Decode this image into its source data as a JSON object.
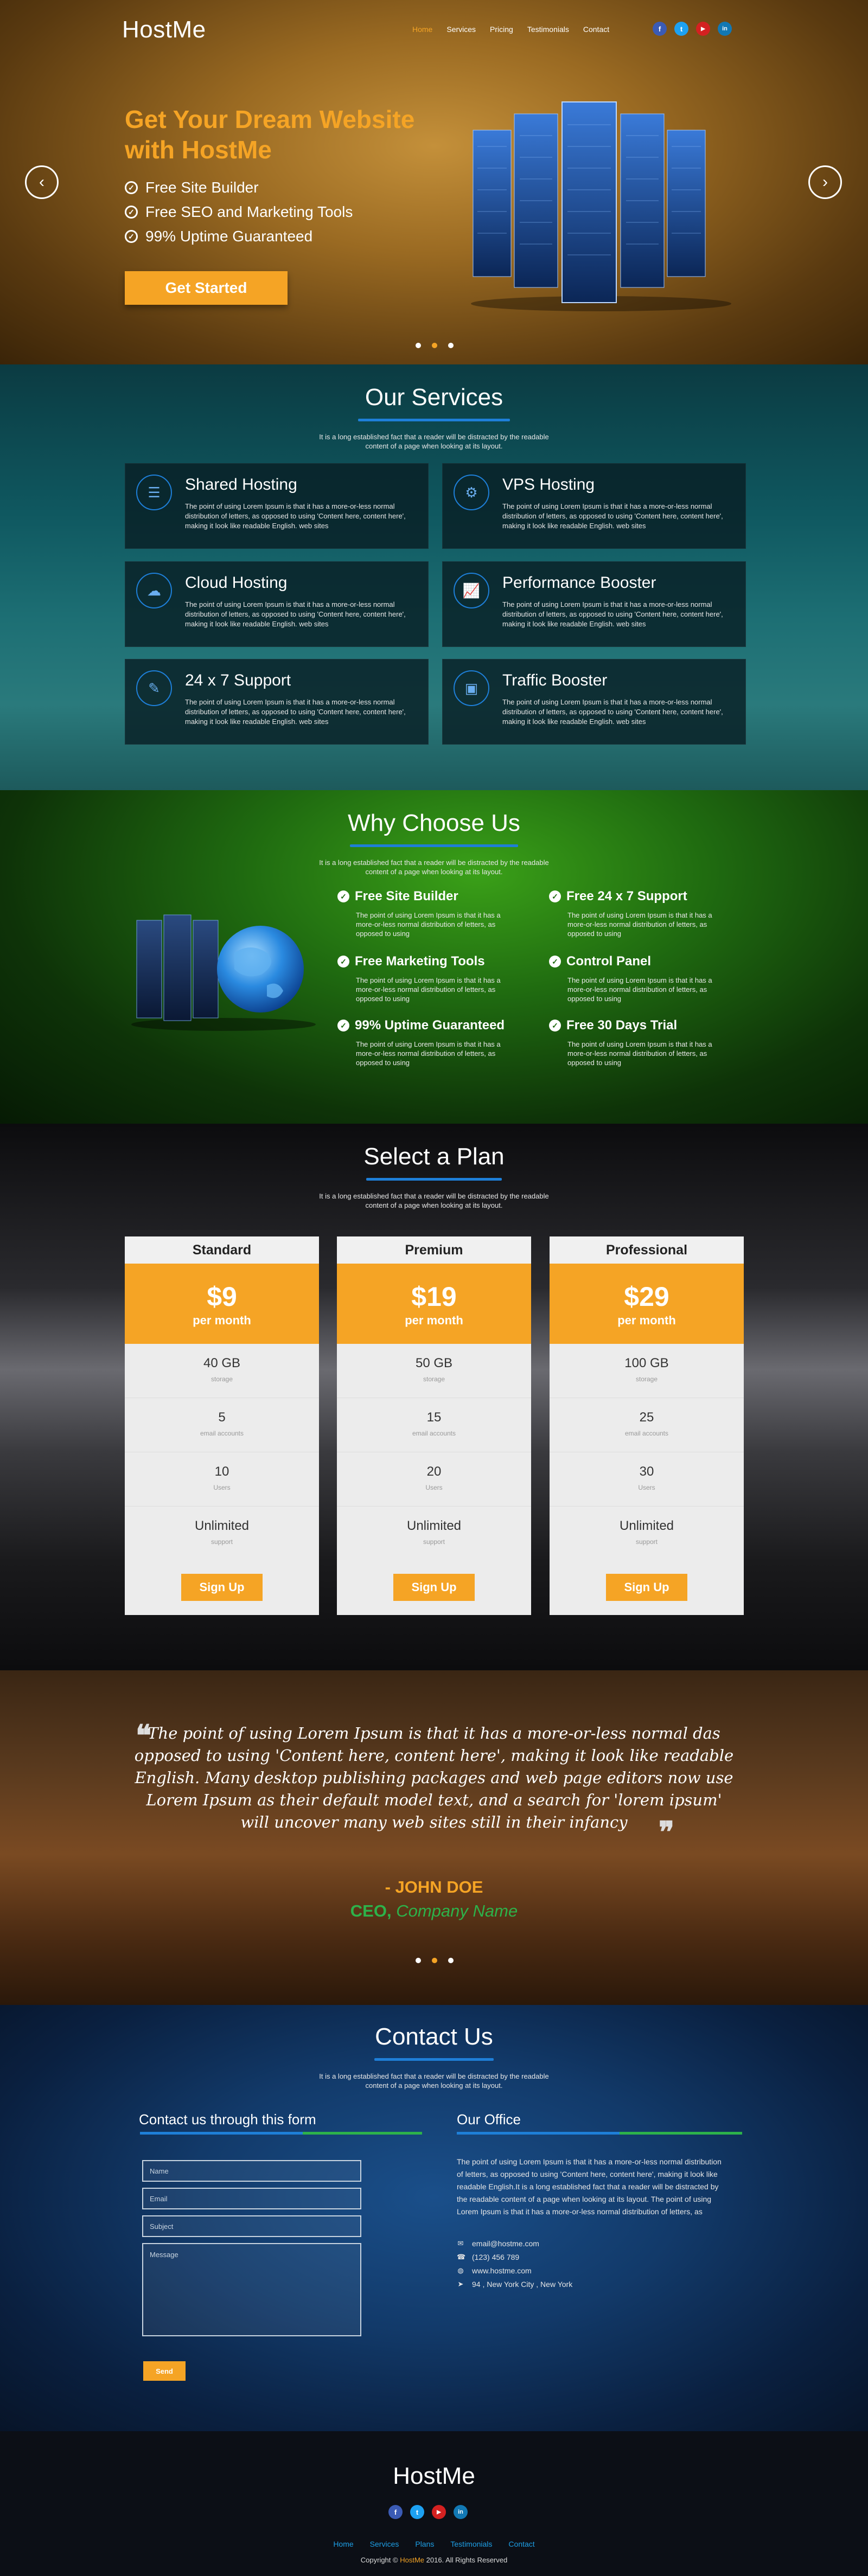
{
  "header": {
    "logo": "HostMe",
    "nav": [
      "Home",
      "Services",
      "Pricing",
      "Testimonials",
      "Contact"
    ],
    "social": [
      "f",
      "t",
      "▶",
      "in"
    ]
  },
  "hero": {
    "headline": "Get Your Dream Website with HostMe",
    "features": [
      "Free Site Builder",
      "Free SEO and Marketing Tools",
      "99% Uptime Guaranteed"
    ],
    "cta": "Get Started",
    "prev": "‹",
    "next": "›"
  },
  "services": {
    "title": "Our Services",
    "subtitle": "It is a long established fact that a reader will be distracted by the readable content of a page when looking at its layout.",
    "items": [
      {
        "icon": "☰",
        "title": "Shared Hosting",
        "text": "The point of using Lorem Ipsum is that it has a more-or-less normal distribution of letters, as opposed to using 'Content here, content here', making it look like readable English. web sites"
      },
      {
        "icon": "⚙",
        "title": "VPS Hosting",
        "text": "The point of using Lorem Ipsum is that it has a more-or-less normal distribution of letters, as opposed to using 'Content here, content here', making it look like readable English. web sites"
      },
      {
        "icon": "☁",
        "title": "Cloud Hosting",
        "text": "The point of using Lorem Ipsum is that it has a more-or-less normal distribution of letters, as opposed to using 'Content here, content here', making it look like readable English. web sites"
      },
      {
        "icon": "📈",
        "title": "Performance Booster",
        "text": "The point of using Lorem Ipsum is that it has a more-or-less normal distribution of letters, as opposed to using 'Content here, content here', making it look like readable English. web sites"
      },
      {
        "icon": "✎",
        "title": "24 x 7 Support",
        "text": "The point of using Lorem Ipsum is that it has a more-or-less normal distribution of letters, as opposed to using 'Content here, content here', making it look like readable English. web sites"
      },
      {
        "icon": "▣",
        "title": "Traffic Booster",
        "text": "The point of using Lorem Ipsum is that it has a more-or-less normal distribution of letters, as opposed to using 'Content here, content here', making it look like readable English. web sites"
      }
    ]
  },
  "why": {
    "title": "Why Choose Us",
    "subtitle": "It is a long established fact that a reader will be distracted by the readable content of a page when looking at its layout.",
    "items": [
      {
        "title": "Free Site Builder",
        "text": "The point of using Lorem Ipsum is that it has a more-or-less normal distribution of letters, as opposed to using"
      },
      {
        "title": "Free 24 x 7 Support",
        "text": "The point of using Lorem Ipsum is that it has a more-or-less normal distribution of letters, as opposed to using"
      },
      {
        "title": "Free Marketing Tools",
        "text": "The point of using Lorem Ipsum is that it has a more-or-less normal distribution of letters, as opposed to using"
      },
      {
        "title": "Control Panel",
        "text": "The point of using Lorem Ipsum is that it has a more-or-less normal distribution of letters, as opposed to using"
      },
      {
        "title": "99% Uptime Guaranteed",
        "text": "The point of using Lorem Ipsum is that it has a more-or-less normal distribution of letters, as opposed to using"
      },
      {
        "title": "Free 30 Days Trial",
        "text": "The point of using Lorem Ipsum is that it has a more-or-less normal distribution of letters, as opposed to using"
      }
    ]
  },
  "plans": {
    "title": "Select a Plan",
    "subtitle": "It is a long established fact that a reader will be distracted by the readable content of a page when looking at its layout.",
    "items": [
      {
        "name": "Standard",
        "price": "$9",
        "per": "per month",
        "storage": "40 GB",
        "email": "5",
        "users": "10",
        "support": "Unlimited",
        "cta": "Sign Up"
      },
      {
        "name": "Premium",
        "price": "$19",
        "per": "per month",
        "storage": "50 GB",
        "email": "15",
        "users": "20",
        "support": "Unlimited",
        "cta": "Sign Up"
      },
      {
        "name": "Professional",
        "price": "$29",
        "per": "per month",
        "storage": "100 GB",
        "email": "25",
        "users": "30",
        "support": "Unlimited",
        "cta": "Sign Up"
      }
    ],
    "labels": {
      "storage": "storage",
      "email": "email accounts",
      "users": "Users",
      "support": "support"
    }
  },
  "testimonial": {
    "quote": "The point of using Lorem Ipsum is that it has a more-or-less normal das opposed to using 'Content here, content here', making it look like readable English. Many desktop publishing packages and web page editors now use Lorem Ipsum as their default model text, and a search for 'lorem ipsum' will uncover many web sites still in their infancy",
    "open_quote": "❝",
    "close_quote": "❞",
    "author": "- JOHN DOE",
    "role": "CEO",
    "company": "Company Name"
  },
  "contact": {
    "title": "Contact Us",
    "subtitle": "It is a long established fact that a reader will be distracted by the readable content of a page when looking at its layout.",
    "form_heading": "Contact us through this form",
    "name_placeholder": "Name",
    "email_placeholder": "Email",
    "subject_placeholder": "Subject",
    "message_placeholder": "Message",
    "send": "Send",
    "office_heading": "Our Office",
    "office_text": "The point of using Lorem Ipsum is that it has a more-or-less normal distribution of letters, as opposed to using 'Content here, content here', making it look like readable English.It is a long established fact that a reader will be distracted by the readable content of a page when looking at its layout. The point of using Lorem Ipsum is that it has a more-or-less normal distribution of letters, as",
    "email": "email@hostme.com",
    "phone": "(123) 456 789",
    "web": "www.hostme.com",
    "address": "94 , New York City , New York"
  },
  "footer": {
    "logo": "HostMe",
    "social": [
      "f",
      "t",
      "▶",
      "in"
    ],
    "nav": [
      "Home",
      "Services",
      "Plans",
      "Testimonials",
      "Contact"
    ],
    "copy_pre": "Copyright ©",
    "copy_brand": "HostMe",
    "copy_post": "2016. All Rights Reserved"
  },
  "colors": {
    "accent": "#f5a425",
    "blue": "#1e7fd8",
    "green": "#2db24a"
  }
}
